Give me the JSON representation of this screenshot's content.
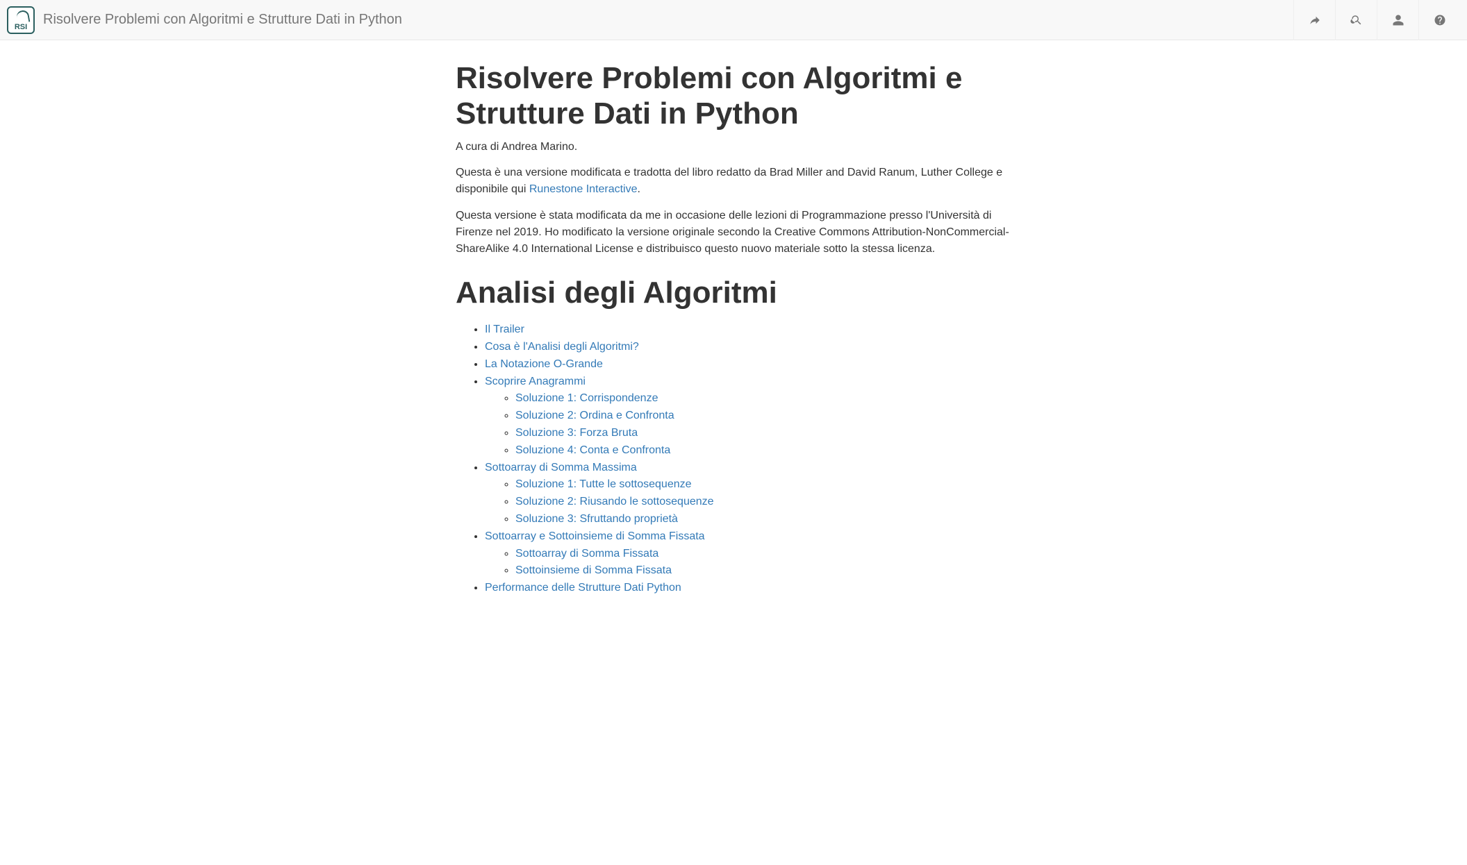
{
  "navbar": {
    "logo_label": "RSI",
    "title": "Risolvere Problemi con Algoritmi e Strutture Dati in Python"
  },
  "page": {
    "heading": "Risolvere Problemi con Algoritmi e Strutture Dati in Python",
    "byline": "A cura di Andrea Marino.",
    "intro_p1_a": "Questa è una versione modificata e tradotta del libro redatto da Brad Miller and David Ranum, Luther College e disponibile qui ",
    "intro_p1_link": "Runestone Interactive",
    "intro_p1_b": ".",
    "intro_p2": "Questa versione è stata modificata da me in occasione delle lezioni di Programmazione presso l'Università di Firenze nel 2019. Ho modificato la versione originale secondo la Creative Commons Attribution-NonCommercial-ShareAlike 4.0 International License e distribuisco questo nuovo materiale sotto la stessa licenza."
  },
  "section1": {
    "title": "Analisi degli Algoritmi",
    "items": [
      {
        "label": "Il Trailer"
      },
      {
        "label": "Cosa è l'Analisi degli Algoritmi?"
      },
      {
        "label": "La Notazione O-Grande"
      },
      {
        "label": "Scoprire Anagrammi",
        "children": [
          {
            "label": "Soluzione 1: Corrispondenze"
          },
          {
            "label": "Soluzione 2: Ordina e Confronta"
          },
          {
            "label": "Soluzione 3: Forza Bruta"
          },
          {
            "label": "Soluzione 4: Conta e Confronta"
          }
        ]
      },
      {
        "label": "Sottoarray di Somma Massima",
        "children": [
          {
            "label": "Soluzione 1: Tutte le sottosequenze"
          },
          {
            "label": "Soluzione 2: Riusando le sottosequenze"
          },
          {
            "label": "Soluzione 3: Sfruttando proprietà"
          }
        ]
      },
      {
        "label": "Sottoarray e Sottoinsieme di Somma Fissata",
        "children": [
          {
            "label": "Sottoarray di Somma Fissata"
          },
          {
            "label": "Sottoinsieme di Somma Fissata"
          }
        ]
      },
      {
        "label": "Performance delle Strutture Dati Python"
      }
    ]
  }
}
